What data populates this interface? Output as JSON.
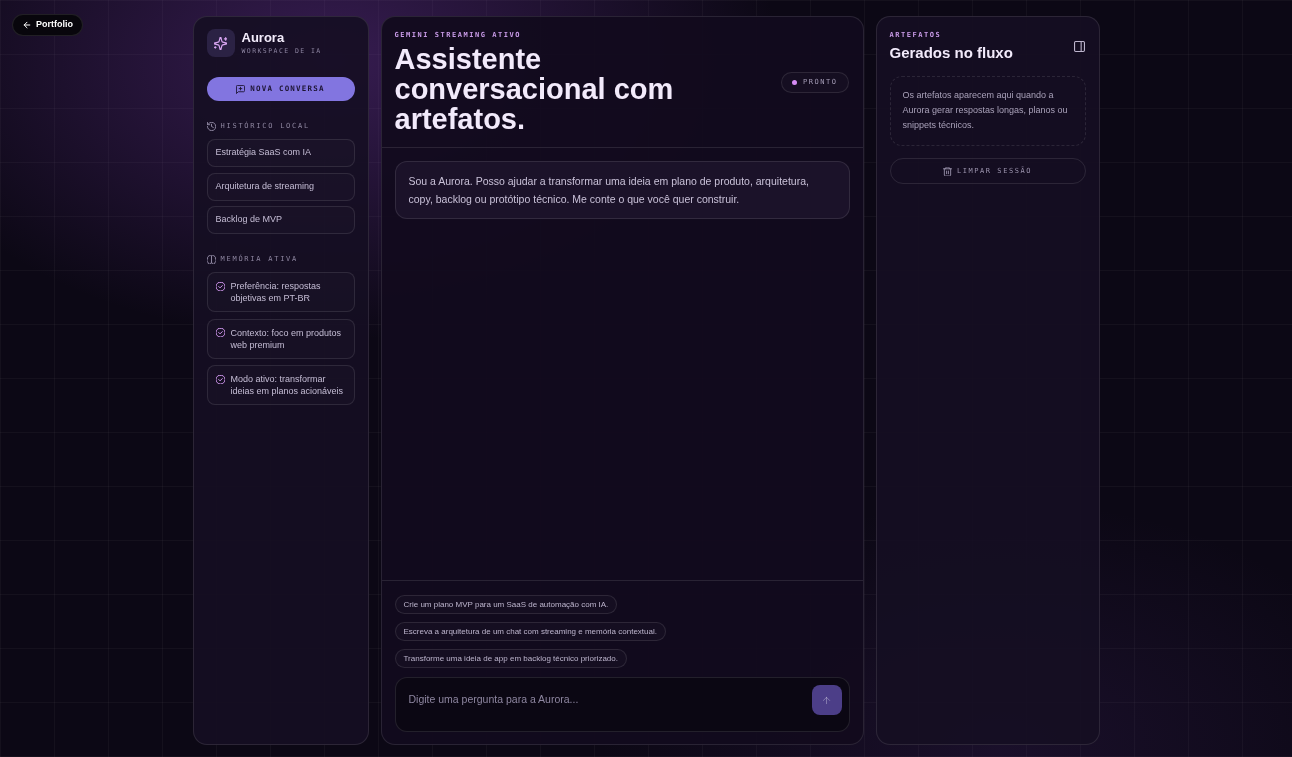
{
  "back_link": {
    "label": "Portfolio"
  },
  "sidebar": {
    "brand": {
      "name": "Aurora",
      "subtitle": "WORKSPACE DE IA"
    },
    "new_chat_button": {
      "label": "NOVA CONVERSA"
    },
    "history": {
      "heading": "HISTÓRICO LOCAL",
      "items": [
        {
          "label": "Estratégia SaaS com IA",
          "selected": false
        },
        {
          "label": "Arquitetura de streaming",
          "selected": false
        },
        {
          "label": "Backlog de MVP",
          "selected": false
        }
      ]
    },
    "memory": {
      "heading": "MEMÓRIA ATIVA",
      "items": [
        {
          "text": "Preferência: respostas objetivas em PT-BR"
        },
        {
          "text": "Contexto: foco em produtos web premium"
        },
        {
          "text": "Modo ativo: transformar ideias em planos acionáveis"
        }
      ]
    }
  },
  "chat": {
    "eyebrow": "GEMINI STREAMING ATIVO",
    "title": "Assistente conversacional com artefatos.",
    "status": {
      "label": "PRONTO"
    },
    "messages": [
      {
        "kind": "assistant",
        "text": "Sou a Aurora. Posso ajudar a transformar uma ideia em plano de produto, arquitetura, copy, backlog ou protótipo técnico. Me conte o que você quer construir."
      }
    ],
    "suggestions": [
      "Crie um plano MVP para um SaaS de automação com IA.",
      "Escreva a arquitetura de um chat com streaming e memória contextual.",
      "Transforme uma ideia de app em backlog técnico priorizado."
    ],
    "composer": {
      "placeholder": "Digite uma pergunta para a Aurora...",
      "send_disabled": true
    }
  },
  "artifacts": {
    "eyebrow": "ARTEFATOS",
    "title": "Gerados no fluxo",
    "empty_text": "Os artefatos aparecem aqui quando a Aurora gerar respostas longas, planos ou snippets técnicos.",
    "clear_button": {
      "label": "LIMPAR SESSÃO"
    }
  }
}
